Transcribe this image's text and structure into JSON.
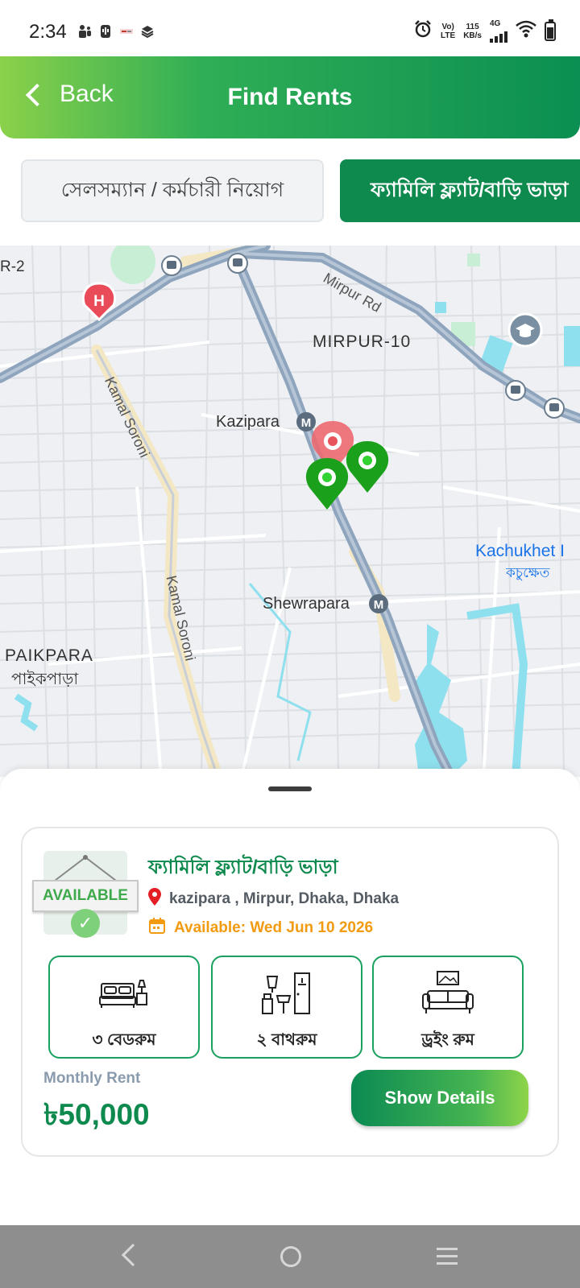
{
  "status_bar": {
    "time": "2:34",
    "volte_line1": "Vo)",
    "volte_line2": "LTE",
    "speed_line1": "115",
    "speed_line2": "KB/s",
    "network": "4G"
  },
  "header": {
    "back_label": "Back",
    "title": "Find Rents",
    "gradient_colors": [
      "#8bd14a",
      "#0b8f52"
    ]
  },
  "categories": [
    {
      "label": "সেলসম্যান / কর্মচারী নিয়োগ",
      "active": false
    },
    {
      "label": "ফ্যামিলি ফ্ল্যাট/বাড়ি ভাড়া",
      "active": true
    }
  ],
  "map": {
    "labels": {
      "mirpur2": "R-2",
      "mirpur10": "MIRPUR-10",
      "mirpur_rd": "Mirpur Rd",
      "kazipara": "Kazipara",
      "kamal_soroni_1": "Kamal Soroni",
      "kamal_soroni_2": "Kamal Soroni",
      "shewrapara": "Shewrapara",
      "paikpara_en": "PAIKPARA",
      "paikpara_bn": "পাইকপাড়া",
      "kachukhet_en": "Kachukhet I",
      "kachukhet_bn": "কচুক্ষেত"
    },
    "markers": [
      {
        "type": "selected",
        "color": "#e8535a"
      },
      {
        "type": "listing",
        "color": "#1aa01a"
      },
      {
        "type": "listing",
        "color": "#1aa01a"
      }
    ]
  },
  "listing": {
    "badge_text": "AVAILABLE",
    "title": "ফ্যামিলি ফ্ল্যাট/বাড়ি ভাড়া",
    "location": "kazipara , Mirpur, Dhaka, Dhaka",
    "available": "Available: Wed Jun 10 2026",
    "features": [
      {
        "label": "৩ বেডরুম",
        "icon": "bed-icon"
      },
      {
        "label": "২ বাথরুম",
        "icon": "bathroom-icon"
      },
      {
        "label": "ড্রইং রুম",
        "icon": "sofa-icon"
      }
    ],
    "rent_label": "Monthly Rent",
    "rent_value": "৳50,000",
    "details_button": "Show Details",
    "accent_color": "#0f8a4e",
    "date_color": "#f29b11"
  }
}
